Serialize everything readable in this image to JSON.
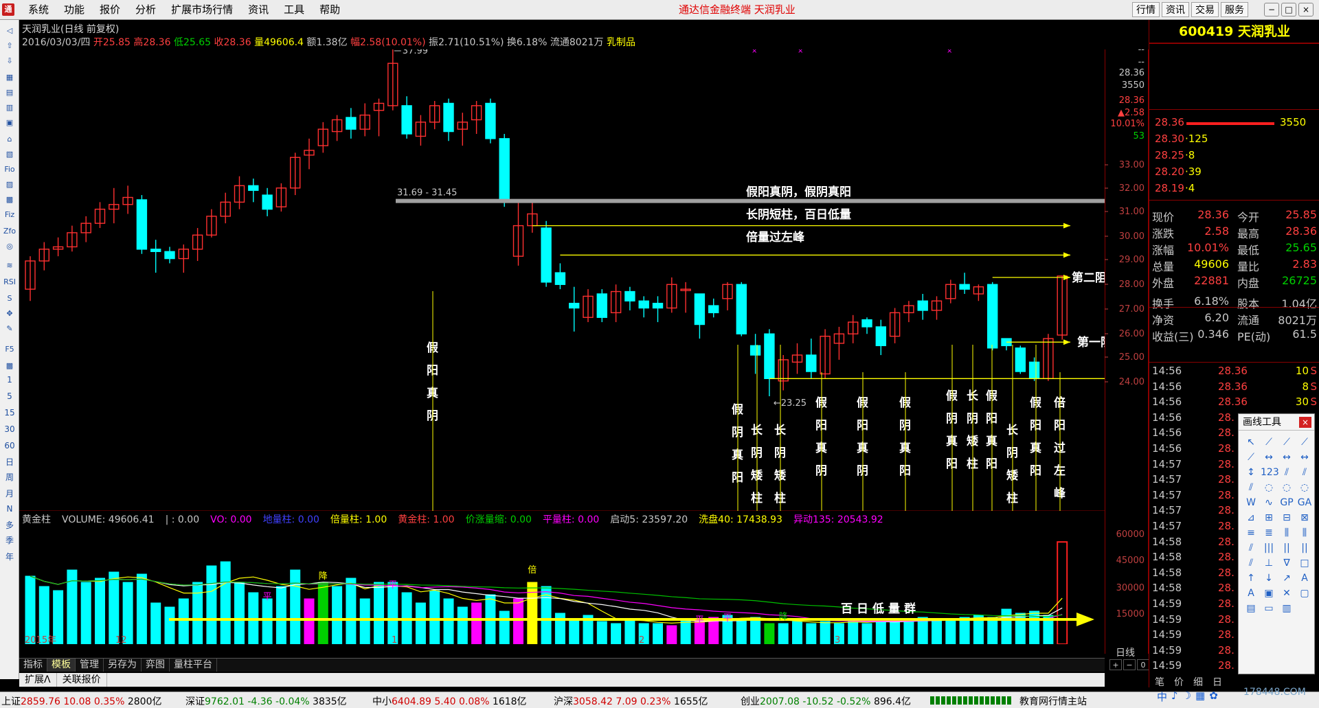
{
  "menu": {
    "logo": "通",
    "items": [
      "系统",
      "功能",
      "报价",
      "分析",
      "扩展市场行情",
      "资讯",
      "工具",
      "帮助"
    ],
    "center_title": "通达信金融终端  天润乳业",
    "right_buttons": [
      "行情",
      "资讯",
      "交易",
      "服务"
    ],
    "window_buttons": [
      "−",
      "□",
      "×"
    ]
  },
  "chart_header": {
    "title": "天润乳业(日线 前复权)",
    "date": "2016/03/03/四",
    "open_label": "开",
    "open": "25.85",
    "high_label": "高",
    "high": "28.36",
    "low_label": "低",
    "low": "25.65",
    "close_label": "收",
    "close": "28.36",
    "vol_label": "量",
    "vol": "49606.4",
    "amt_label": "额",
    "amt": "1.38亿",
    "chg_label": "幅",
    "chg": "2.58(10.01%)",
    "amp_label": "振",
    "amp": "2.71(10.51%)",
    "turn_label": "换",
    "turn": "6.18%",
    "float_label": "流通",
    "float": "8021万",
    "sector": "乳制品"
  },
  "price_labels": {
    "peak": "37.99",
    "gap_range": "31.69 - 31.45",
    "low": "23.25",
    "cursor_close": "28.36",
    "cursor_vol": "3550",
    "axis_ticks": [
      "--",
      "--",
      "28.36",
      "3550",
      "28.36",
      "▲2.58",
      "10.01%",
      "53",
      "33.00",
      "32.00",
      "31.00",
      "30.00",
      "29.00",
      "28.00",
      "27.00",
      "26.00",
      "25.00",
      "24.00"
    ],
    "volume_ticks": [
      "60000",
      "45000",
      "30000",
      "15000"
    ]
  },
  "annotations": {
    "top_text": [
      "假阳真阴，假阴真阳",
      "长阴短柱，百日低量",
      "倍量过左峰"
    ],
    "second_resistance": "第二阻力位",
    "first_resistance": "第一阻力位",
    "hundred_day_low": "百日低量群",
    "vertical_labels": [
      {
        "text": "假阳真阴"
      },
      {
        "text": "假阴真阳"
      },
      {
        "text": "长阴矮柱"
      },
      {
        "text": "长阴矮柱"
      },
      {
        "text": "假阳真阴"
      },
      {
        "text": "假阳真阴"
      },
      {
        "text": "假阴真阳"
      },
      {
        "text": "假阴真阳"
      },
      {
        "text": "长阴矮柱"
      },
      {
        "text": "假阳真阳"
      },
      {
        "text": "长阴矮柱"
      },
      {
        "text": "假阳真阳"
      },
      {
        "text": "倍阳过左峰"
      }
    ]
  },
  "volume_header": [
    {
      "text": "黄金柱",
      "color": "#c8c8c8"
    },
    {
      "text": "VOLUME: 49606.41",
      "color": "#c8c8c8"
    },
    {
      "text": "| : 0.00",
      "color": "#c8c8c8"
    },
    {
      "text": "VO: 0.00",
      "color": "#ff00ff"
    },
    {
      "text": "地量柱: 0.00",
      "color": "#4040ff"
    },
    {
      "text": "倍量柱: 1.00",
      "color": "#ffff00"
    },
    {
      "text": "黄金柱: 1.00",
      "color": "#ff4040"
    },
    {
      "text": "价涨量缩: 0.00",
      "color": "#00d000"
    },
    {
      "text": "平量柱: 0.00",
      "color": "#ff00ff"
    },
    {
      "text": "启动5: 23597.20",
      "color": "#c8c8c8"
    },
    {
      "text": "洗盘40: 17438.93",
      "color": "#ffff00"
    },
    {
      "text": "异动135: 20543.92",
      "color": "#ff00ff"
    }
  ],
  "volume_marks": {
    "double": "倍",
    "flat": "平",
    "dig": "降"
  },
  "x_axis": {
    "labels": [
      "2015年",
      "12",
      "1",
      "2",
      "3"
    ]
  },
  "tabs": [
    "指标",
    "模板",
    "管理",
    "另存为",
    "弈图",
    "量柱平台"
  ],
  "tabs2": [
    "扩展Λ",
    "关联报价"
  ],
  "day_label": "日线",
  "nav": [
    "+",
    "−",
    "0"
  ],
  "left_toolbar": [
    "◁",
    "⇧",
    "⇩",
    "▦",
    "▤",
    "▥",
    "▣",
    "⌂",
    "▧",
    "Fio",
    "▨",
    "▩",
    "Fiz",
    "Zfo",
    "◎",
    "≋",
    "RSI",
    "S",
    "✥",
    "✎",
    "F5",
    "▩",
    "1",
    "5",
    "15",
    "30",
    "60",
    "日",
    "周",
    "月",
    "N",
    "多",
    "季",
    "年"
  ],
  "right_panel": {
    "code_name": "600419 天润乳业",
    "order_book": [
      {
        "price": "28.36",
        "vol": "3550"
      },
      {
        "price": "28.30",
        "vol": "·125"
      },
      {
        "price": "28.25",
        "vol": "·8"
      },
      {
        "price": "28.20",
        "vol": "·39"
      },
      {
        "price": "28.19",
        "vol": "·4"
      }
    ],
    "quote": [
      {
        "k": "现价",
        "v": "28.36",
        "k2": "今开",
        "v2": "25.85",
        "c": "#ff4040",
        "c2": "#ff4040"
      },
      {
        "k": "涨跌",
        "v": "2.58",
        "k2": "最高",
        "v2": "28.36",
        "c": "#ff4040",
        "c2": "#ff4040"
      },
      {
        "k": "涨幅",
        "v": "10.01%",
        "k2": "最低",
        "v2": "25.65",
        "c": "#ff4040",
        "c2": "#00d000"
      },
      {
        "k": "总量",
        "v": "49606",
        "k2": "量比",
        "v2": "2.83",
        "c": "#ffff00",
        "c2": "#ff4040"
      },
      {
        "k": "外盘",
        "v": "22881",
        "k2": "内盘",
        "v2": "26725",
        "c": "#ff4040",
        "c2": "#00d000"
      },
      {
        "k": "换手",
        "v": "6.18%",
        "k2": "股本",
        "v2": "1.04亿",
        "c": "#c8c8c8",
        "c2": "#c8c8c8"
      },
      {
        "k": "净资",
        "v": "6.20",
        "k2": "流通",
        "v2": "8021万",
        "c": "#c8c8c8",
        "c2": "#c8c8c8"
      },
      {
        "k": "收益(三)",
        "v": "0.346",
        "k2": "PE(动)",
        "v2": "61.5",
        "c": "#c8c8c8",
        "c2": "#c8c8c8"
      }
    ],
    "ticks": [
      {
        "t": "14:56",
        "p": "28.36",
        "n": "10",
        "s": "S"
      },
      {
        "t": "14:56",
        "p": "28.36",
        "n": "8",
        "s": "S"
      },
      {
        "t": "14:56",
        "p": "28.36",
        "n": "30",
        "s": "S"
      },
      {
        "t": "14:56",
        "p": "28.",
        "n": "",
        "s": ""
      },
      {
        "t": "14:56",
        "p": "28.",
        "n": "",
        "s": ""
      },
      {
        "t": "14:56",
        "p": "28.",
        "n": "",
        "s": ""
      },
      {
        "t": "14:57",
        "p": "28.",
        "n": "",
        "s": ""
      },
      {
        "t": "14:57",
        "p": "28.",
        "n": "",
        "s": ""
      },
      {
        "t": "14:57",
        "p": "28.",
        "n": "",
        "s": ""
      },
      {
        "t": "14:57",
        "p": "28.",
        "n": "",
        "s": ""
      },
      {
        "t": "14:57",
        "p": "28.",
        "n": "",
        "s": ""
      },
      {
        "t": "14:58",
        "p": "28.",
        "n": "",
        "s": ""
      },
      {
        "t": "14:58",
        "p": "28.",
        "n": "",
        "s": ""
      },
      {
        "t": "14:58",
        "p": "28.",
        "n": "",
        "s": ""
      },
      {
        "t": "14:58",
        "p": "28.",
        "n": "",
        "s": ""
      },
      {
        "t": "14:59",
        "p": "28.",
        "n": "",
        "s": ""
      },
      {
        "t": "14:59",
        "p": "28.",
        "n": "",
        "s": ""
      },
      {
        "t": "14:59",
        "p": "28.",
        "n": "",
        "s": ""
      },
      {
        "t": "14:59",
        "p": "28.",
        "n": "",
        "s": ""
      },
      {
        "t": "14:59",
        "p": "28.",
        "n": "",
        "s": ""
      }
    ],
    "bottom_tabs": [
      "笔",
      "价",
      "细",
      "日"
    ]
  },
  "draw_tools": {
    "title": "画线工具",
    "close": "×",
    "icons": [
      "↖",
      "⟋",
      "⟋",
      "⟋",
      "⟋",
      "↔",
      "↔",
      "↔",
      "↕",
      "123",
      "⫽",
      "⫽",
      "⫽",
      "◌",
      "◌",
      "◌",
      "W",
      "∿",
      "GP",
      "GA",
      "⊿",
      "⊞",
      "⊟",
      "⊠",
      "≡",
      "≣",
      "⫼",
      "⫼",
      "⫽",
      "|||",
      "||",
      "||",
      "⫽",
      "⊥",
      "∇",
      "□",
      "↑",
      "↓",
      "↗",
      "A",
      "A",
      "▣",
      "✕",
      "▢",
      "▤",
      "▭",
      "▥",
      ""
    ]
  },
  "status_bar": [
    {
      "name": "上证",
      "price": "2859.76",
      "chg": "10.08",
      "pct": "0.35%",
      "amt": "2800亿"
    },
    {
      "name": "深证",
      "price": "9762.01",
      "chg": "-4.36",
      "pct": "-0.04%",
      "amt": "3835亿"
    },
    {
      "name": "中小",
      "price": "6404.89",
      "chg": "5.40",
      "pct": "0.08%",
      "amt": "1618亿"
    },
    {
      "name": "沪深",
      "price": "3058.42",
      "chg": "7.09",
      "pct": "0.23%",
      "amt": "1655亿"
    },
    {
      "name": "创业",
      "price": "2007.08",
      "chg": "-10.52",
      "pct": "-0.52%",
      "amt": "896.4亿"
    }
  ],
  "status_right": "教育网行情主站",
  "ime": [
    "中",
    "♪",
    "☽",
    "▦",
    "✿"
  ],
  "watermark": "178448.COM",
  "colors": {
    "up_candle": "#ff3030",
    "down_candle": "#00ffff",
    "ma_white": "#ffffff",
    "ma_yellow": "#ffff00",
    "ma_magenta": "#ff00ff",
    "ma_green": "#00c000",
    "resistance_gray": "#a0a0a0",
    "volume_line": "#ffff00"
  },
  "candles": [
    [
      27.8,
      29.0,
      27.3,
      29.2
    ],
    [
      29.0,
      29.5,
      28.6,
      29.8
    ],
    [
      29.5,
      29.6,
      29.2,
      30.0
    ],
    [
      29.6,
      30.2,
      29.4,
      30.5
    ],
    [
      30.2,
      30.6,
      29.8,
      30.9
    ],
    [
      30.6,
      31.2,
      30.4,
      31.5
    ],
    [
      31.2,
      31.4,
      30.6,
      32.1
    ],
    [
      31.4,
      31.7,
      31.0,
      32.2
    ],
    [
      31.6,
      29.5,
      29.3,
      31.8
    ],
    [
      29.5,
      29.4,
      28.5,
      29.9
    ],
    [
      29.4,
      29.1,
      28.9,
      29.6
    ],
    [
      29.1,
      29.5,
      28.5,
      29.7
    ],
    [
      29.5,
      30.1,
      29.0,
      30.4
    ],
    [
      30.1,
      30.9,
      30.0,
      31.2
    ],
    [
      30.9,
      31.5,
      30.6,
      31.9
    ],
    [
      31.5,
      32.2,
      31.2,
      32.6
    ],
    [
      32.2,
      32.0,
      31.5,
      32.5
    ],
    [
      31.8,
      31.2,
      30.9,
      32.1
    ],
    [
      31.3,
      32.1,
      31.1,
      32.3
    ],
    [
      32.1,
      33.4,
      31.8,
      33.6
    ],
    [
      33.5,
      33.7,
      32.9,
      34.2
    ],
    [
      33.9,
      34.6,
      33.6,
      34.9
    ],
    [
      34.5,
      35.0,
      34.1,
      35.2
    ],
    [
      35.1,
      34.6,
      34.2,
      35.5
    ],
    [
      34.6,
      35.2,
      34.3,
      35.7
    ],
    [
      35.4,
      35.7,
      34.3,
      35.9
    ],
    [
      35.6,
      37.4,
      35.4,
      37.99
    ],
    [
      35.6,
      34.4,
      34.2,
      36.0
    ],
    [
      34.3,
      34.9,
      33.9,
      35.2
    ],
    [
      34.9,
      35.6,
      34.6,
      35.8
    ],
    [
      35.7,
      34.5,
      34.1,
      35.9
    ],
    [
      34.6,
      34.9,
      33.9,
      35.3
    ],
    [
      35.0,
      35.6,
      34.4,
      35.8
    ],
    [
      35.7,
      34.2,
      34.0,
      35.9
    ],
    [
      34.2,
      31.5,
      31.3,
      34.4
    ],
    [
      29.2,
      30.5,
      28.8,
      31.5
    ],
    [
      30.5,
      31.0,
      30.2,
      31.5
    ],
    [
      30.4,
      28.1,
      27.9,
      30.7
    ],
    [
      28.5,
      28.0,
      27.8,
      28.9
    ],
    [
      27.2,
      27.0,
      26.0,
      27.9
    ],
    [
      26.6,
      27.5,
      26.4,
      27.8
    ],
    [
      27.6,
      26.6,
      26.4,
      27.8
    ],
    [
      26.8,
      27.7,
      26.4,
      28.0
    ],
    [
      27.7,
      27.3,
      26.9,
      27.9
    ],
    [
      27.3,
      27.0,
      26.6,
      27.5
    ],
    [
      27.2,
      27.0,
      26.4,
      27.5
    ],
    [
      27.0,
      28.0,
      26.8,
      28.3
    ],
    [
      27.8,
      27.8,
      26.8,
      28.1
    ],
    [
      27.6,
      26.3,
      25.7,
      27.6
    ],
    [
      27.1,
      26.8,
      26.6,
      27.4
    ],
    [
      27.4,
      28.0,
      26.9,
      28.1
    ],
    [
      28.0,
      25.9,
      25.8,
      28.1
    ],
    [
      25.4,
      25.0,
      24.2,
      25.9
    ],
    [
      25.9,
      24.0,
      23.25,
      26.1
    ],
    [
      23.9,
      24.8,
      23.5,
      25.0
    ],
    [
      24.7,
      25.0,
      24.2,
      25.5
    ],
    [
      25.0,
      24.3,
      24.0,
      25.7
    ],
    [
      24.2,
      25.8,
      24.0,
      26.1
    ],
    [
      25.5,
      25.9,
      24.8,
      26.2
    ],
    [
      25.9,
      26.4,
      25.5,
      26.7
    ],
    [
      26.5,
      26.2,
      25.9,
      26.6
    ],
    [
      26.2,
      25.4,
      25.0,
      26.5
    ],
    [
      25.8,
      26.8,
      25.5,
      27.0
    ],
    [
      26.8,
      27.1,
      26.4,
      27.3
    ],
    [
      27.3,
      26.9,
      26.5,
      27.6
    ],
    [
      26.9,
      27.3,
      26.5,
      27.5
    ],
    [
      27.4,
      28.0,
      27.2,
      28.2
    ],
    [
      28.0,
      27.8,
      27.6,
      28.5
    ],
    [
      27.6,
      27.9,
      27.3,
      28.0
    ],
    [
      28.0,
      25.3,
      25.2,
      28.1
    ],
    [
      25.7,
      25.4,
      25.2,
      25.7
    ],
    [
      25.3,
      24.3,
      24.2,
      25.4
    ],
    [
      24.7,
      24.0,
      23.9,
      24.9
    ],
    [
      24.0,
      25.7,
      23.9,
      25.9
    ],
    [
      25.85,
      28.36,
      25.65,
      28.36
    ]
  ],
  "volumes": [
    [
      33000,
      "c"
    ],
    [
      28000,
      "c"
    ],
    [
      26000,
      "c"
    ],
    [
      36000,
      "c"
    ],
    [
      30000,
      "c"
    ],
    [
      32000,
      "c"
    ],
    [
      35000,
      "c"
    ],
    [
      30000,
      "c"
    ],
    [
      34000,
      "c"
    ],
    [
      20000,
      "c"
    ],
    [
      18000,
      "c"
    ],
    [
      22000,
      "c"
    ],
    [
      30000,
      "c"
    ],
    [
      38000,
      "c"
    ],
    [
      40000,
      "c"
    ],
    [
      30000,
      "c"
    ],
    [
      25000,
      "c"
    ],
    [
      22000,
      "c"
    ],
    [
      28000,
      "c"
    ],
    [
      36000,
      "c"
    ],
    [
      22000,
      "m"
    ],
    [
      30000,
      "g"
    ],
    [
      28000,
      "c"
    ],
    [
      32000,
      "c"
    ],
    [
      22000,
      "c"
    ],
    [
      30000,
      "c"
    ],
    [
      30000,
      "c"
    ],
    [
      25000,
      "c"
    ],
    [
      20000,
      "c"
    ],
    [
      26000,
      "c"
    ],
    [
      22000,
      "c"
    ],
    [
      18000,
      "c"
    ],
    [
      20000,
      "m"
    ],
    [
      24000,
      "c"
    ],
    [
      16000,
      "c"
    ],
    [
      22000,
      "m"
    ],
    [
      30000,
      "y"
    ],
    [
      28000,
      "c"
    ],
    [
      15000,
      "c"
    ],
    [
      12000,
      "c"
    ],
    [
      14000,
      "c"
    ],
    [
      11000,
      "c"
    ],
    [
      10000,
      "c"
    ],
    [
      12000,
      "c"
    ],
    [
      10000,
      "c"
    ],
    [
      10000,
      "c"
    ],
    [
      9000,
      "m"
    ],
    [
      12000,
      "c"
    ],
    [
      12000,
      "m"
    ],
    [
      13000,
      "m"
    ],
    [
      14000,
      "c"
    ],
    [
      12000,
      "c"
    ],
    [
      13000,
      "c"
    ],
    [
      10000,
      "g"
    ],
    [
      10000,
      "c"
    ],
    [
      11000,
      "c"
    ],
    [
      10000,
      "c"
    ],
    [
      11000,
      "c"
    ],
    [
      10000,
      "c"
    ],
    [
      12000,
      "c"
    ],
    [
      10000,
      "c"
    ],
    [
      12000,
      "c"
    ],
    [
      12000,
      "c"
    ],
    [
      12000,
      "c"
    ],
    [
      13000,
      "c"
    ],
    [
      12000,
      "c"
    ],
    [
      12000,
      "c"
    ],
    [
      13000,
      "c"
    ],
    [
      14000,
      "c"
    ],
    [
      13000,
      "c"
    ],
    [
      17000,
      "c"
    ],
    [
      15000,
      "c"
    ],
    [
      16000,
      "c"
    ],
    [
      14000,
      "c"
    ],
    [
      49606,
      "r"
    ]
  ]
}
